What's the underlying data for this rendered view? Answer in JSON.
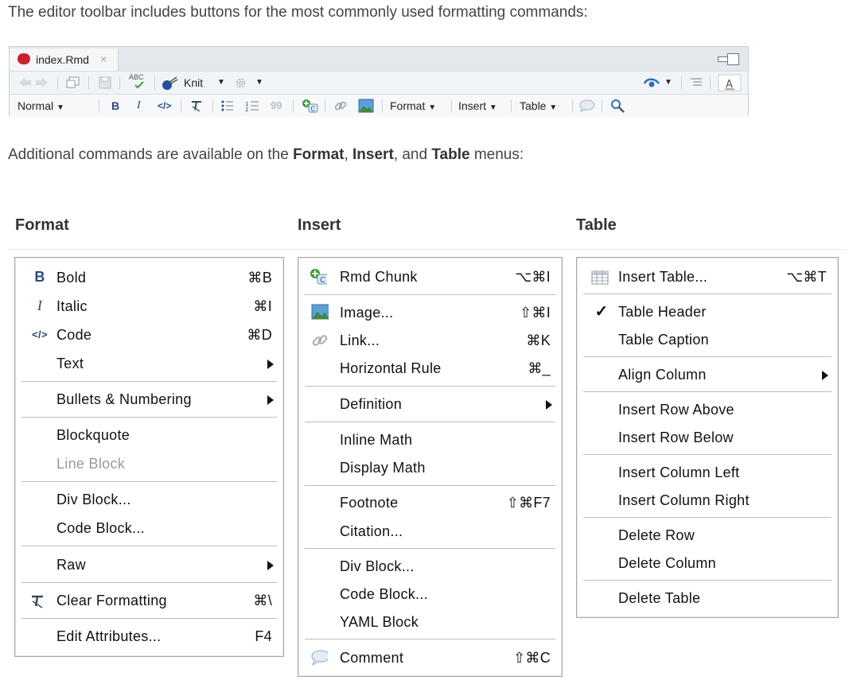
{
  "intro_text": "The editor toolbar includes buttons for the most commonly used formatting commands:",
  "intro2": {
    "prefix": "Additional commands are available on the ",
    "format": "Format",
    "comma": ", ",
    "insert": "Insert",
    "and": ", and ",
    "table": "Table",
    "suffix": " menus:"
  },
  "editor": {
    "tab_label": "index.Rmd",
    "tab_close": "×",
    "toolbar": {
      "knit_label": "Knit",
      "style_label": "Normal",
      "format_label": "Format",
      "insert_label": "Insert",
      "table_label": "Table",
      "bold": "B",
      "italic": "I",
      "code": "</>",
      "abc": "ABC",
      "quote": "99"
    }
  },
  "menus": {
    "format": {
      "title": "Format",
      "items": [
        {
          "icon": "B",
          "label": "Bold",
          "shortcut": "⌘B"
        },
        {
          "icon": "I",
          "label": "Italic",
          "shortcut": "⌘I"
        },
        {
          "icon": "</>",
          "label": "Code",
          "shortcut": "⌘D"
        },
        {
          "label": "Text"
        },
        {
          "label": "Bullets & Numbering"
        },
        {
          "label": "Blockquote"
        },
        {
          "label": "Line Block"
        },
        {
          "label": "Div Block..."
        },
        {
          "label": "Code Block..."
        },
        {
          "label": "Raw"
        },
        {
          "label": "Clear Formatting",
          "shortcut": "⌘\\"
        },
        {
          "label": "Edit Attributes...",
          "shortcut": "F4"
        }
      ]
    },
    "insert": {
      "title": "Insert",
      "items": [
        {
          "label": "Rmd Chunk",
          "shortcut": "⌥⌘I"
        },
        {
          "label": "Image...",
          "shortcut": "⇧⌘I"
        },
        {
          "label": "Link...",
          "shortcut": "⌘K"
        },
        {
          "label": "Horizontal Rule",
          "shortcut": "⌘_"
        },
        {
          "label": "Definition"
        },
        {
          "label": "Inline Math"
        },
        {
          "label": "Display Math"
        },
        {
          "label": "Footnote",
          "shortcut": "⇧⌘F7"
        },
        {
          "label": "Citation..."
        },
        {
          "label": "Div Block..."
        },
        {
          "label": "Code Block..."
        },
        {
          "label": "YAML Block"
        },
        {
          "label": "Comment",
          "shortcut": "⇧⌘C"
        }
      ]
    },
    "table": {
      "title": "Table",
      "items": [
        {
          "label": "Insert Table...",
          "shortcut": "⌥⌘T"
        },
        {
          "label": "Table Header",
          "check": "✓"
        },
        {
          "label": "Table Caption"
        },
        {
          "label": "Align Column"
        },
        {
          "label": "Insert Row Above"
        },
        {
          "label": "Insert Row Below"
        },
        {
          "label": "Insert Column Left"
        },
        {
          "label": "Insert Column Right"
        },
        {
          "label": "Delete Row"
        },
        {
          "label": "Delete Column"
        },
        {
          "label": "Delete Table"
        }
      ]
    }
  },
  "colors": {
    "accent_blue": "#2a6ebb",
    "rmd_red": "#c8202f",
    "chunk_green": "#3a9d3a"
  }
}
